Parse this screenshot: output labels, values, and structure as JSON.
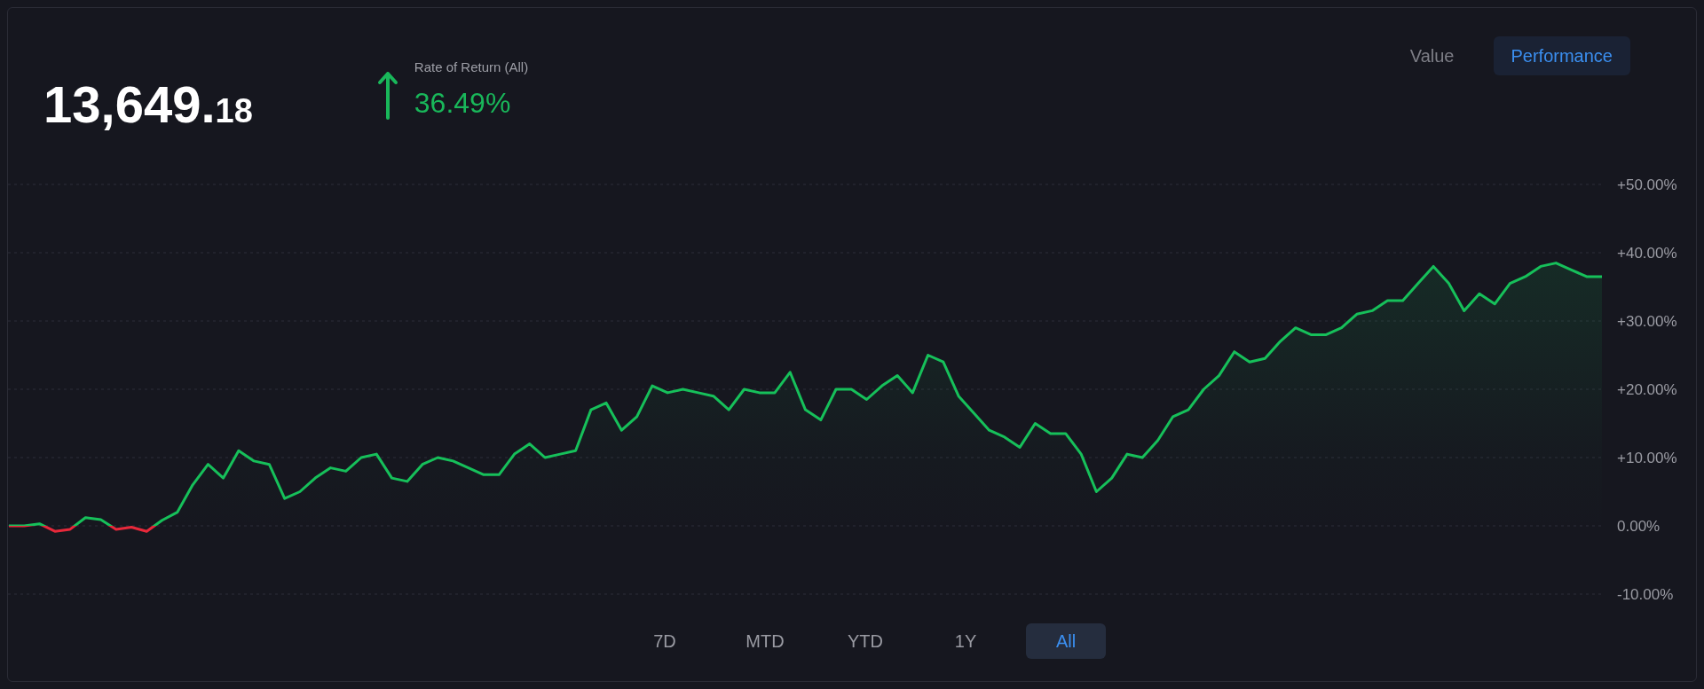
{
  "balance": {
    "integer": "13,649.",
    "decimals": "18"
  },
  "return": {
    "label": "Rate of Return (All)",
    "value": "36.49%",
    "positive": true
  },
  "view_toggle": [
    {
      "label": "Value",
      "selected": false
    },
    {
      "label": "Performance",
      "selected": true
    }
  ],
  "chart_data": {
    "type": "area",
    "grid": true,
    "yticks": [
      {
        "value": 50,
        "label": "+50.00%"
      },
      {
        "value": 40,
        "label": "+40.00%"
      },
      {
        "value": 30,
        "label": "+30.00%"
      },
      {
        "value": 20,
        "label": "+20.00%"
      },
      {
        "value": 10,
        "label": "+10.00%"
      },
      {
        "value": 0,
        "label": "0.00%"
      },
      {
        "value": -10,
        "label": "-10.00%"
      }
    ],
    "ylim": [
      -10,
      50
    ],
    "series": [
      {
        "color": "#16c05a",
        "values": [
          0,
          0,
          0.3,
          -0.8,
          -0.5,
          1.2,
          0.9,
          -0.5,
          -0.2,
          -0.8,
          0.8,
          2,
          6,
          9,
          7,
          11,
          9.5,
          9,
          4,
          5,
          7,
          8.5,
          8,
          10,
          10.5,
          7,
          6.5,
          9,
          10,
          9.5,
          8.5,
          7.5,
          7.5,
          10.5,
          12,
          10,
          10.5,
          11,
          17,
          18,
          14,
          16,
          20.5,
          19.5,
          20,
          19.5,
          19,
          17,
          20,
          19.5,
          19.5,
          22.5,
          17,
          15.5,
          20,
          20,
          18.5,
          20.5,
          22,
          19.5,
          25,
          24,
          19,
          16.5,
          14,
          13,
          11.5,
          15,
          13.5,
          13.5,
          10.5,
          5,
          7,
          10.5,
          10,
          12.5,
          16,
          17,
          20,
          22,
          25.5,
          24,
          24.5,
          27,
          29,
          28,
          28,
          29,
          31,
          31.5,
          33,
          33,
          35.5,
          38,
          35.5,
          31.5,
          34,
          32.5,
          35.5,
          36.5,
          38,
          38.5,
          37.5,
          36.5,
          36.5
        ]
      }
    ]
  },
  "periods": [
    {
      "label": "7D",
      "selected": false
    },
    {
      "label": "MTD",
      "selected": false
    },
    {
      "label": "YTD",
      "selected": false
    },
    {
      "label": "1Y",
      "selected": false
    },
    {
      "label": "All",
      "selected": true
    }
  ]
}
